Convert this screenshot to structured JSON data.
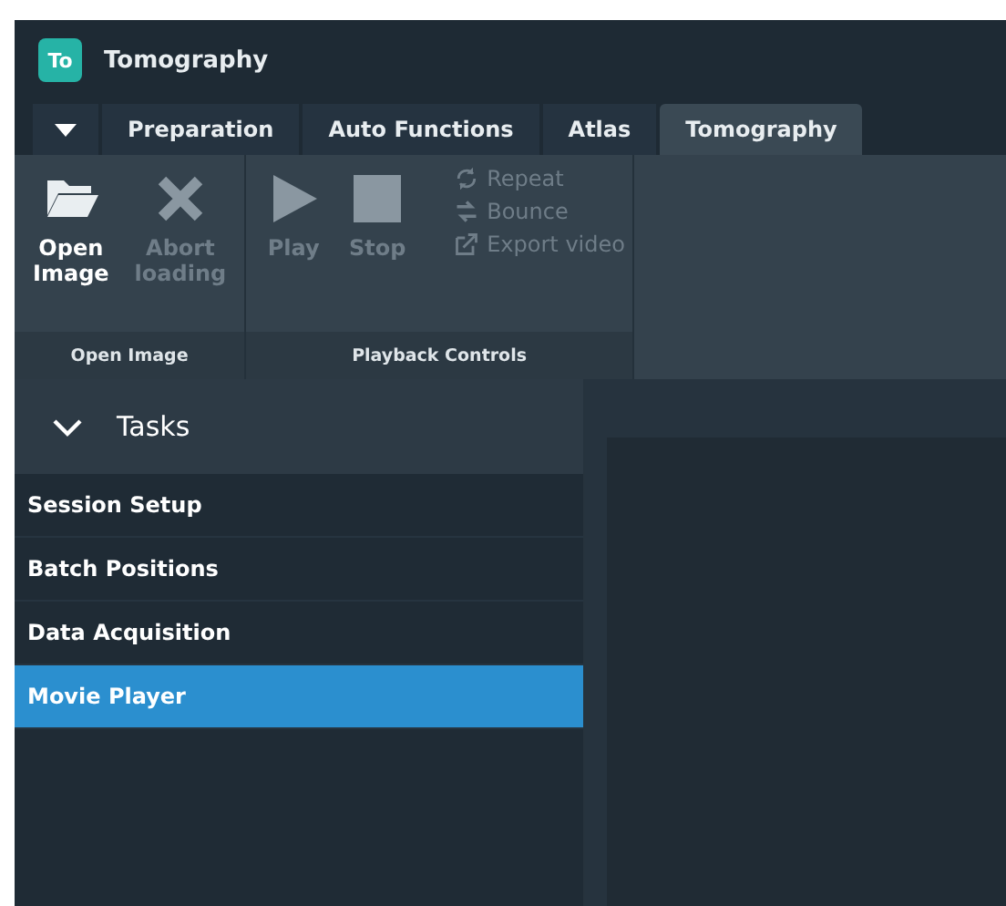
{
  "window": {
    "app_badge": "To",
    "title": "Tomography"
  },
  "tabs": [
    {
      "label": "Preparation",
      "selected": false
    },
    {
      "label": "Auto Functions",
      "selected": false
    },
    {
      "label": "Atlas",
      "selected": false
    },
    {
      "label": "Tomography",
      "selected": true
    }
  ],
  "ribbon": {
    "groups": [
      {
        "label": "Open Image",
        "buttons": [
          {
            "kind": "large",
            "label": "Open\nImage",
            "disabled": false
          },
          {
            "kind": "large",
            "label": "Abort\nloading",
            "disabled": true
          }
        ]
      },
      {
        "label": "Playback Controls",
        "buttons": [
          {
            "kind": "large",
            "label": "Play",
            "disabled": true
          },
          {
            "kind": "large",
            "label": "Stop",
            "disabled": true
          },
          {
            "kind": "stack",
            "items": [
              {
                "label": "Repeat",
                "disabled": true
              },
              {
                "label": "Bounce",
                "disabled": true
              },
              {
                "label": "Export video",
                "disabled": true
              }
            ]
          }
        ]
      }
    ]
  },
  "tasks": {
    "title": "Tasks",
    "expanded": true,
    "items": [
      {
        "label": "Session Setup",
        "selected": false
      },
      {
        "label": "Batch Positions",
        "selected": false
      },
      {
        "label": "Data Acquisition",
        "selected": false
      },
      {
        "label": "Movie Player",
        "selected": true
      }
    ]
  }
}
